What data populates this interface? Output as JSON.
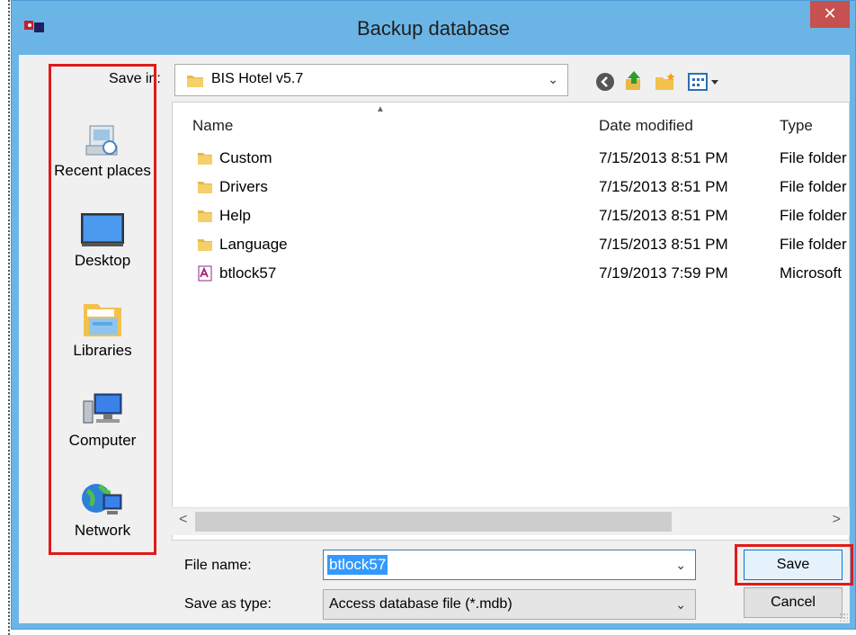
{
  "window": {
    "title": "Backup database",
    "close_label": "✕"
  },
  "save_in": {
    "label": "Save in:",
    "value": "BIS Hotel v5.7"
  },
  "places": [
    {
      "label": "Recent places",
      "icon": "recent-places-icon"
    },
    {
      "label": "Desktop",
      "icon": "desktop-icon"
    },
    {
      "label": "Libraries",
      "icon": "libraries-icon"
    },
    {
      "label": "Computer",
      "icon": "computer-icon"
    },
    {
      "label": "Network",
      "icon": "network-icon"
    }
  ],
  "columns": {
    "name": "Name",
    "date": "Date modified",
    "type": "Type"
  },
  "files": [
    {
      "name": "Custom",
      "date": "7/15/2013 8:51 PM",
      "type": "File folder",
      "icon": "folder-icon"
    },
    {
      "name": "Drivers",
      "date": "7/15/2013 8:51 PM",
      "type": "File folder",
      "icon": "folder-icon"
    },
    {
      "name": "Help",
      "date": "7/15/2013 8:51 PM",
      "type": "File folder",
      "icon": "folder-icon"
    },
    {
      "name": "Language",
      "date": "7/15/2013 8:51 PM",
      "type": "File folder",
      "icon": "folder-icon"
    },
    {
      "name": "btlock57",
      "date": "7/19/2013 7:59 PM",
      "type": "Microsoft",
      "icon": "access-file-icon"
    }
  ],
  "filename": {
    "label": "File name:",
    "value": "btlock57"
  },
  "filetype": {
    "label": "Save as type:",
    "value": "Access database file (*.mdb)"
  },
  "buttons": {
    "save": "Save",
    "cancel": "Cancel"
  },
  "colors": {
    "accent": "#6bb5e6",
    "highlight": "#e01a1a",
    "selection": "#3399ff"
  }
}
